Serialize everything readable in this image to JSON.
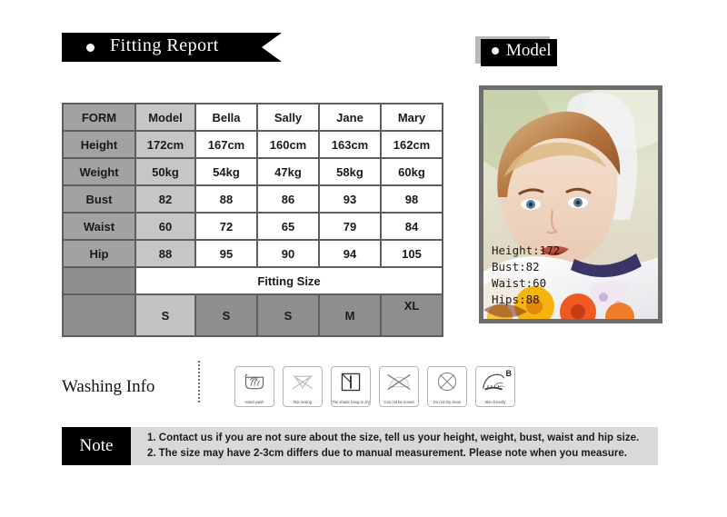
{
  "fitting_report": {
    "title": "Fitting Report",
    "bullet_icon": "bullet-dot-icon"
  },
  "model_badge": {
    "title": "Model",
    "bullet_icon": "bullet-dot-icon"
  },
  "table": {
    "columns": [
      "FORM",
      "Model",
      "Bella",
      "Sally",
      "Jane",
      "Mary"
    ],
    "rows": [
      {
        "label": "Height",
        "values": [
          "172cm",
          "167cm",
          "160cm",
          "163cm",
          "162cm"
        ]
      },
      {
        "label": "Weight",
        "values": [
          "50kg",
          "54kg",
          "47kg",
          "58kg",
          "60kg"
        ]
      },
      {
        "label": "Bust",
        "values": [
          "82",
          "88",
          "86",
          "93",
          "98"
        ]
      },
      {
        "label": "Waist",
        "values": [
          "60",
          "72",
          "65",
          "79",
          "84"
        ]
      },
      {
        "label": "Hip",
        "values": [
          "88",
          "95",
          "90",
          "94",
          "105"
        ]
      }
    ],
    "fitting_size_label": "Fitting Size",
    "sizes": [
      "S",
      "S",
      "S",
      "M",
      "XL"
    ],
    "colors": {
      "label_cell": "#a2a2a2",
      "model_cell": "#c6c6c6",
      "value_cell": "#ffffff",
      "blank_cell": "#8e8e8e",
      "border": "#5e5e5e"
    }
  },
  "model_photo": {
    "alt_name": "model-portrait-photo",
    "stats": [
      "Height:172",
      "Bust:82",
      "Waist:60",
      "Hips:88"
    ],
    "frame_color": "#6d6d6d"
  },
  "washing": {
    "heading": "Washing Info",
    "icons": [
      {
        "name": "hand-wash-icon",
        "label": "Hand wash",
        "corner": ""
      },
      {
        "name": "not-rinsing-icon",
        "label": "Not rinsing",
        "corner": ""
      },
      {
        "name": "shade-hang-dry-icon",
        "label": "The shade hang to dry",
        "corner": ""
      },
      {
        "name": "no-iron-icon",
        "label": "Can not be ironed",
        "corner": ""
      },
      {
        "name": "no-dry-clean-icon",
        "label": "Do not dry clean",
        "corner": ""
      },
      {
        "name": "skin-friendly-icon",
        "label": "Skin-friendly",
        "corner": "B"
      }
    ]
  },
  "note": {
    "badge": "Note",
    "lines": [
      "1. Contact us if you are not sure about the size, tell us your height, weight, bust, waist and hip size.",
      "2. The size may have 2-3cm differs due to manual measurement. Please note when you measure."
    ]
  }
}
